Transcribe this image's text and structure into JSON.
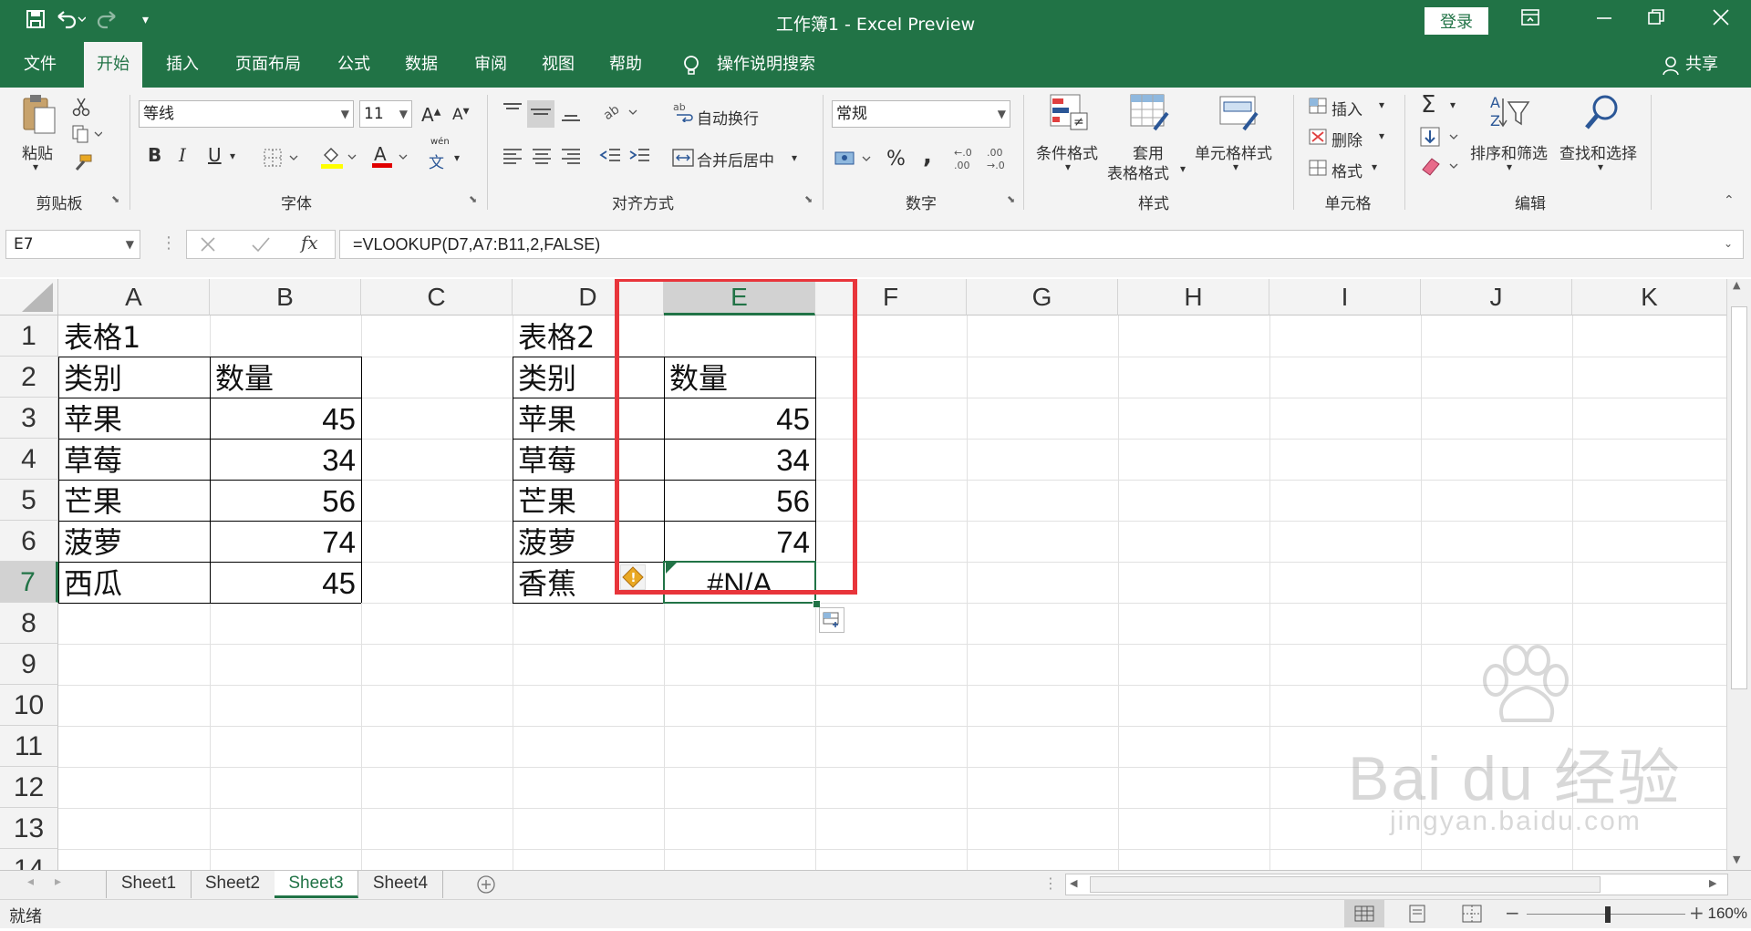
{
  "titlebar": {
    "title": "工作簿1  -  Excel Preview",
    "login": "登录"
  },
  "tabs": [
    "文件",
    "开始",
    "插入",
    "页面布局",
    "公式",
    "数据",
    "审阅",
    "视图",
    "帮助"
  ],
  "tell_me": "操作说明搜索",
  "share": "共享",
  "ribbon": {
    "clipboard": {
      "paste": "粘贴",
      "label": "剪贴板"
    },
    "font": {
      "name": "等线",
      "size": "11",
      "label": "字体",
      "grow": "A",
      "shrink": "A",
      "bold": "B",
      "italic": "I",
      "underline": "U",
      "font_color": "A",
      "phonetic": "文",
      "phonetic_top": "wén"
    },
    "alignment": {
      "wrap": "自动换行",
      "merge": "合并后居中",
      "label": "对齐方式"
    },
    "number": {
      "format": "常规",
      "label": "数字",
      "percent": "%",
      "comma": ","
    },
    "styles": {
      "conditional": "条件格式",
      "table_fmt_1": "套用",
      "table_fmt_2": "表格格式",
      "cell_style": "单元格样式",
      "label": "样式"
    },
    "cells": {
      "insert": "插入",
      "delete": "删除",
      "format": "格式",
      "label": "单元格"
    },
    "editing": {
      "sort": "排序和筛选",
      "find": "查找和选择",
      "label": "编辑"
    }
  },
  "formula_bar": {
    "name_box": "E7",
    "fx": "fx",
    "formula": "=VLOOKUP(D7,A7:B11,2,FALSE)"
  },
  "columns": [
    "A",
    "B",
    "C",
    "D",
    "E",
    "F",
    "G",
    "H",
    "I",
    "J",
    "K"
  ],
  "rows": [
    "1",
    "2",
    "3",
    "4",
    "5",
    "6",
    "7",
    "8",
    "9",
    "10",
    "11",
    "12",
    "13",
    "14"
  ],
  "table1": {
    "title": "表格1",
    "header": [
      "类别",
      "数量"
    ],
    "rows": [
      [
        "苹果",
        "45"
      ],
      [
        "草莓",
        "34"
      ],
      [
        "芒果",
        "56"
      ],
      [
        "菠萝",
        "74"
      ],
      [
        "西瓜",
        "45"
      ]
    ]
  },
  "table2": {
    "title": "表格2",
    "header": [
      "类别",
      "数量"
    ],
    "rows": [
      [
        "苹果",
        "45"
      ],
      [
        "草莓",
        "34"
      ],
      [
        "芒果",
        "56"
      ],
      [
        "菠萝",
        "74"
      ],
      [
        "香蕉",
        "#N/A"
      ]
    ]
  },
  "sheets": [
    "Sheet1",
    "Sheet2",
    "Sheet3",
    "Sheet4"
  ],
  "status": {
    "ready": "就绪",
    "zoom": "160%"
  },
  "watermark": {
    "brand": "Bai du 经验",
    "url": "jingyan.baidu.com"
  },
  "colors": {
    "accent": "#217346",
    "highlight_box": "#e8353b",
    "error_flag": "#e9a823"
  }
}
